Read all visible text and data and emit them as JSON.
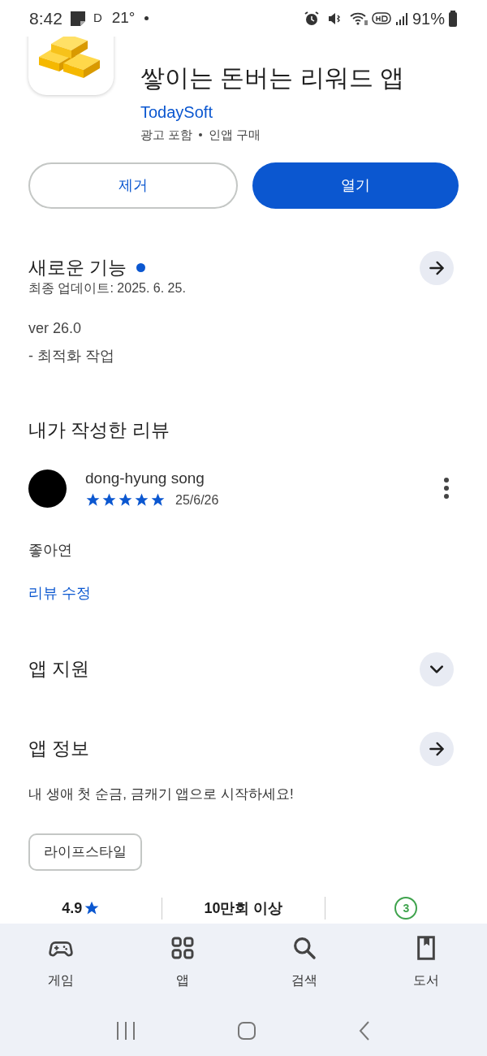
{
  "status_bar": {
    "time": "8:42",
    "notification_letter": "D",
    "temperature": "21°",
    "battery": "91%"
  },
  "app": {
    "title": "쌓이는 돈버는 리워드 앱",
    "developer": "TodaySoft",
    "meta": [
      "광고 포함",
      "인앱 구매"
    ]
  },
  "buttons": [
    {
      "label": "제거",
      "kind": "outline"
    },
    {
      "label": "열기",
      "kind": "filled"
    }
  ],
  "whats_new": {
    "title": "새로운 기능",
    "has_new": true,
    "updated": "최종 업데이트: 2025. 6. 25.",
    "notes": [
      "ver 26.0",
      "- 최적화 작업"
    ]
  },
  "my_review": {
    "title": "내가 작성한 리뷰",
    "author": "dong-hyung song",
    "stars": 5,
    "date": "25/6/26",
    "text": "좋아연",
    "edit_link": "리뷰 수정"
  },
  "app_support": {
    "title": "앱 지원",
    "expanded": false
  },
  "app_info": {
    "title": "앱 정보",
    "description": "내 생애 첫 순금, 금캐기 앱으로 시작하세요!",
    "tag": "라이프스타일"
  },
  "stats": [
    {
      "kind": "rating",
      "value": "4.9"
    },
    {
      "kind": "text",
      "value": "10만회 이상"
    },
    {
      "kind": "age",
      "value": "3"
    }
  ],
  "bottom_nav": [
    {
      "kind": "games",
      "label": "게임"
    },
    {
      "kind": "apps",
      "label": "앱"
    },
    {
      "kind": "search",
      "label": "검색"
    },
    {
      "kind": "books",
      "label": "도서"
    }
  ]
}
